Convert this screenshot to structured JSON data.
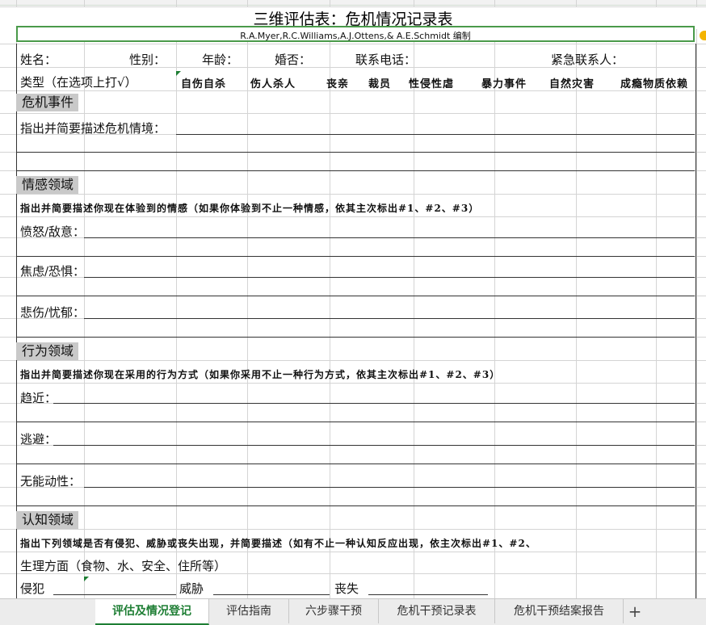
{
  "sheet": {
    "title": "三维评估表：危机情况记录表",
    "authors": "R.A.Myer,R.C.Williams,A.J.Ottens,& A.E.Schmidt 编制",
    "basic_info": {
      "name": "姓名：",
      "gender": "性别：",
      "age": "年龄：",
      "marital": "婚否：",
      "phone": "联系电话：",
      "emergency_contact": "紧急联系人："
    },
    "type_row": {
      "label": "类型（在选项上打√）",
      "options": [
        "自伤自杀",
        "伤人杀人",
        "丧亲",
        "裁员",
        "性侵性虐",
        "暴力事件",
        "自然灾害",
        "成瘾物质依赖"
      ]
    },
    "crisis_event": {
      "header": "危机事件",
      "prompt": "指出并简要描述危机情境："
    },
    "affective": {
      "header": "情感领域",
      "instruction": "指出并简要描述你现在体验到的情感（如果你体验到不止一种情感，依其主次标出#1、#2、#3）",
      "items": [
        "愤怒/敌意：",
        "焦虑/恐惧：",
        "悲伤/忧郁："
      ]
    },
    "behavioral": {
      "header": "行为领域",
      "instruction": "指出并简要描述你现在采用的行为方式（如果你采用不止一种行为方式，依其主次标出#1、#2、#3）",
      "items": [
        "趋近：",
        "逃避：",
        "无能动性："
      ]
    },
    "cognitive": {
      "header": "认知领域",
      "instruction": "指出下列领域是否有侵犯、威胁或丧失出现，并简要描述（如有不止一种认知反应出现，依主次标出#1、#2、",
      "physical": "生理方面（食物、水、安全、住所等）",
      "violation": "侵犯",
      "threat": "威胁",
      "loss": "丧失"
    }
  },
  "tabs": [
    "评估及情况登记",
    "评估指南",
    "六步骤干预",
    "危机干预记录表",
    "危机干预结案报告"
  ],
  "add_tab_label": "+",
  "colors": {
    "accent": "#1e7e34",
    "header_bg": "#c9c9c9",
    "selection": "#4a9a4a"
  }
}
